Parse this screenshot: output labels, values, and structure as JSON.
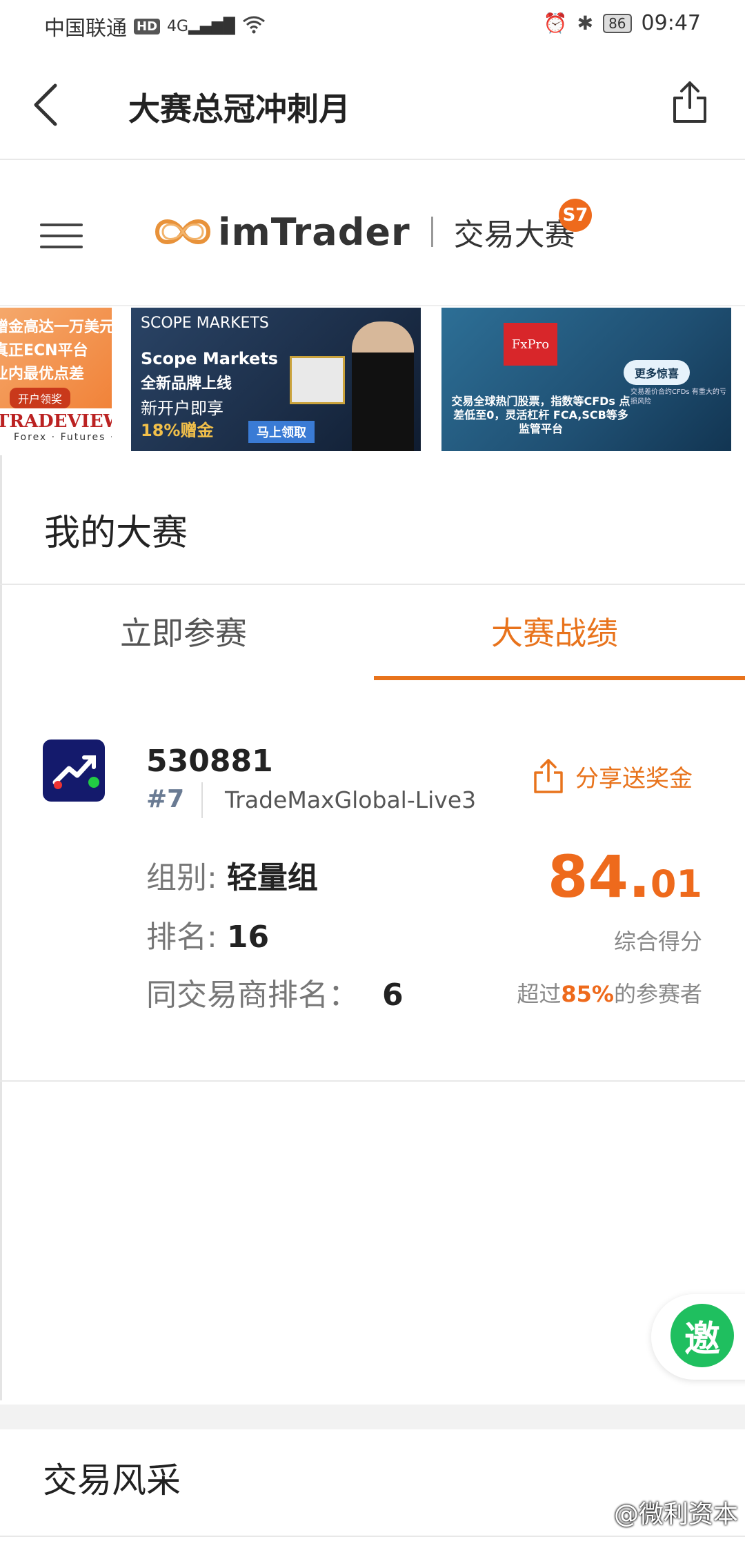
{
  "status_bar": {
    "carrier": "中国联通",
    "hd": "HD",
    "network": "4G",
    "battery": "86",
    "time": "09:47"
  },
  "header": {
    "title": "大赛总冠冲刺月"
  },
  "brand": {
    "name": "imTrader",
    "subtitle": "交易大赛",
    "season_badge": "S7",
    "accent": "#ee6a1c"
  },
  "banners": [
    {
      "lines": [
        "赠金高达一万美元",
        "真正ECN平台",
        "业内最优点差"
      ],
      "button": "开户领奖",
      "brand": "TRADEVIEW",
      "tagline": "Forex · Futures · Stocks"
    },
    {
      "brand": "SCOPE MARKETS",
      "line1": "Scope Markets",
      "line2": "全新品牌上线",
      "line3": "新开户即享",
      "line4": "18%赠金",
      "cta": "马上领取"
    },
    {
      "brand": "FxPro",
      "more": "更多惊喜",
      "text": "交易全球热门股票，指数等CFDs 点差低至0，灵活杠杆 FCA,SCB等多监管平台",
      "fine": "交易差价合约CFDs 有重大的亏损风险"
    }
  ],
  "my_contest": {
    "title": "我的大赛",
    "tabs": [
      {
        "label": "立即参赛",
        "active": false
      },
      {
        "label": "大赛战绩",
        "active": true
      }
    ]
  },
  "record": {
    "account_id": "530881",
    "rank_tag": "#7",
    "server": "TradeMaxGlobal-Live3",
    "share_label": "分享送奖金",
    "group_key": "组别:",
    "group_value": "轻量组",
    "rank_key": "排名:",
    "rank_value": "16",
    "broker_rank_key": "同交易商排名：",
    "broker_rank_value": "6",
    "score_int": "84.",
    "score_dec": "01",
    "score_label": "综合得分",
    "beat_prefix": "超过",
    "beat_pct": "85%",
    "beat_suffix": "的参赛者"
  },
  "invite": {
    "label": "邀",
    "color": "#1fbf5f"
  },
  "bottom": {
    "title": "交易风采",
    "watermark": "@微利资本"
  },
  "icons": [
    "back-arrow-icon",
    "share-icon",
    "menu-icon",
    "alarm-icon",
    "bluetooth-icon",
    "wifi-icon",
    "signal-icon"
  ]
}
